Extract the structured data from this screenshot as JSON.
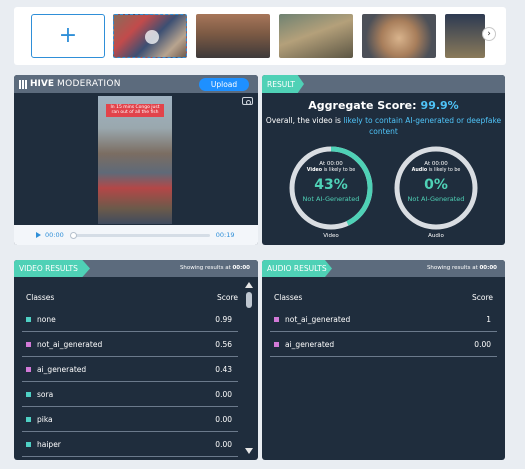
{
  "thumbnails": {
    "add_label": "+",
    "items": [
      "video-thumbnail-1",
      "video-thumbnail-2",
      "video-thumbnail-3",
      "video-thumbnail-4",
      "video-thumbnail-5"
    ],
    "next_icon": "chevron-right-icon"
  },
  "hive": {
    "logo_main": "HIVE",
    "logo_sub": "MODERATION",
    "upload_label": "Upload",
    "video_caption": "In 15 mins Congo just ran out of all the fish",
    "player": {
      "time_current": "00:00",
      "time_total": "00:19",
      "progress": 0
    }
  },
  "result": {
    "tab_label": "RESULT",
    "aggregate_label": "Aggregate Score:",
    "aggregate_value": "99.9%",
    "summary_prefix": "Overall, the video is ",
    "summary_highlight": "likely to contain AI-generated or deepfake content",
    "video_gauge": {
      "time": "At 00:00",
      "subject": "Video",
      "likely_text": " is likely to be",
      "percent": "43%",
      "percent_value": 43,
      "verdict": "Not AI-Generated",
      "label": "Video"
    },
    "audio_gauge": {
      "time": "At 00:00",
      "subject": "Audio",
      "likely_text": " is likely to be",
      "percent": "0%",
      "percent_value": 0,
      "verdict": "Not AI-Generated",
      "label": "Audio"
    }
  },
  "video_results": {
    "tab_label": "VIDEO RESULTS",
    "showing_prefix": "Showing results at ",
    "showing_time": "00:00",
    "col_classes": "Classes",
    "col_score": "Score",
    "rows": [
      {
        "name": "none",
        "score": "0.99",
        "color": "#4fd1c5"
      },
      {
        "name": "not_ai_generated",
        "score": "0.56",
        "color": "#d27ad8"
      },
      {
        "name": "ai_generated",
        "score": "0.43",
        "color": "#d27ad8"
      },
      {
        "name": "sora",
        "score": "0.00",
        "color": "#4fd1c5"
      },
      {
        "name": "pika",
        "score": "0.00",
        "color": "#4fd1c5"
      },
      {
        "name": "haiper",
        "score": "0.00",
        "color": "#4fd1c5"
      }
    ]
  },
  "audio_results": {
    "tab_label": "AUDIO RESULTS",
    "showing_prefix": "Showing results at ",
    "showing_time": "00:00",
    "col_classes": "Classes",
    "col_score": "Score",
    "rows": [
      {
        "name": "not_ai_generated",
        "score": "1",
        "color": "#d27ad8"
      },
      {
        "name": "ai_generated",
        "score": "0.00",
        "color": "#d27ad8"
      }
    ]
  },
  "colors": {
    "accent_teal": "#4fd1b6",
    "accent_blue": "#1e90ff",
    "panel_bg": "#1f2d3d",
    "header_bg": "#5c6b7d"
  }
}
